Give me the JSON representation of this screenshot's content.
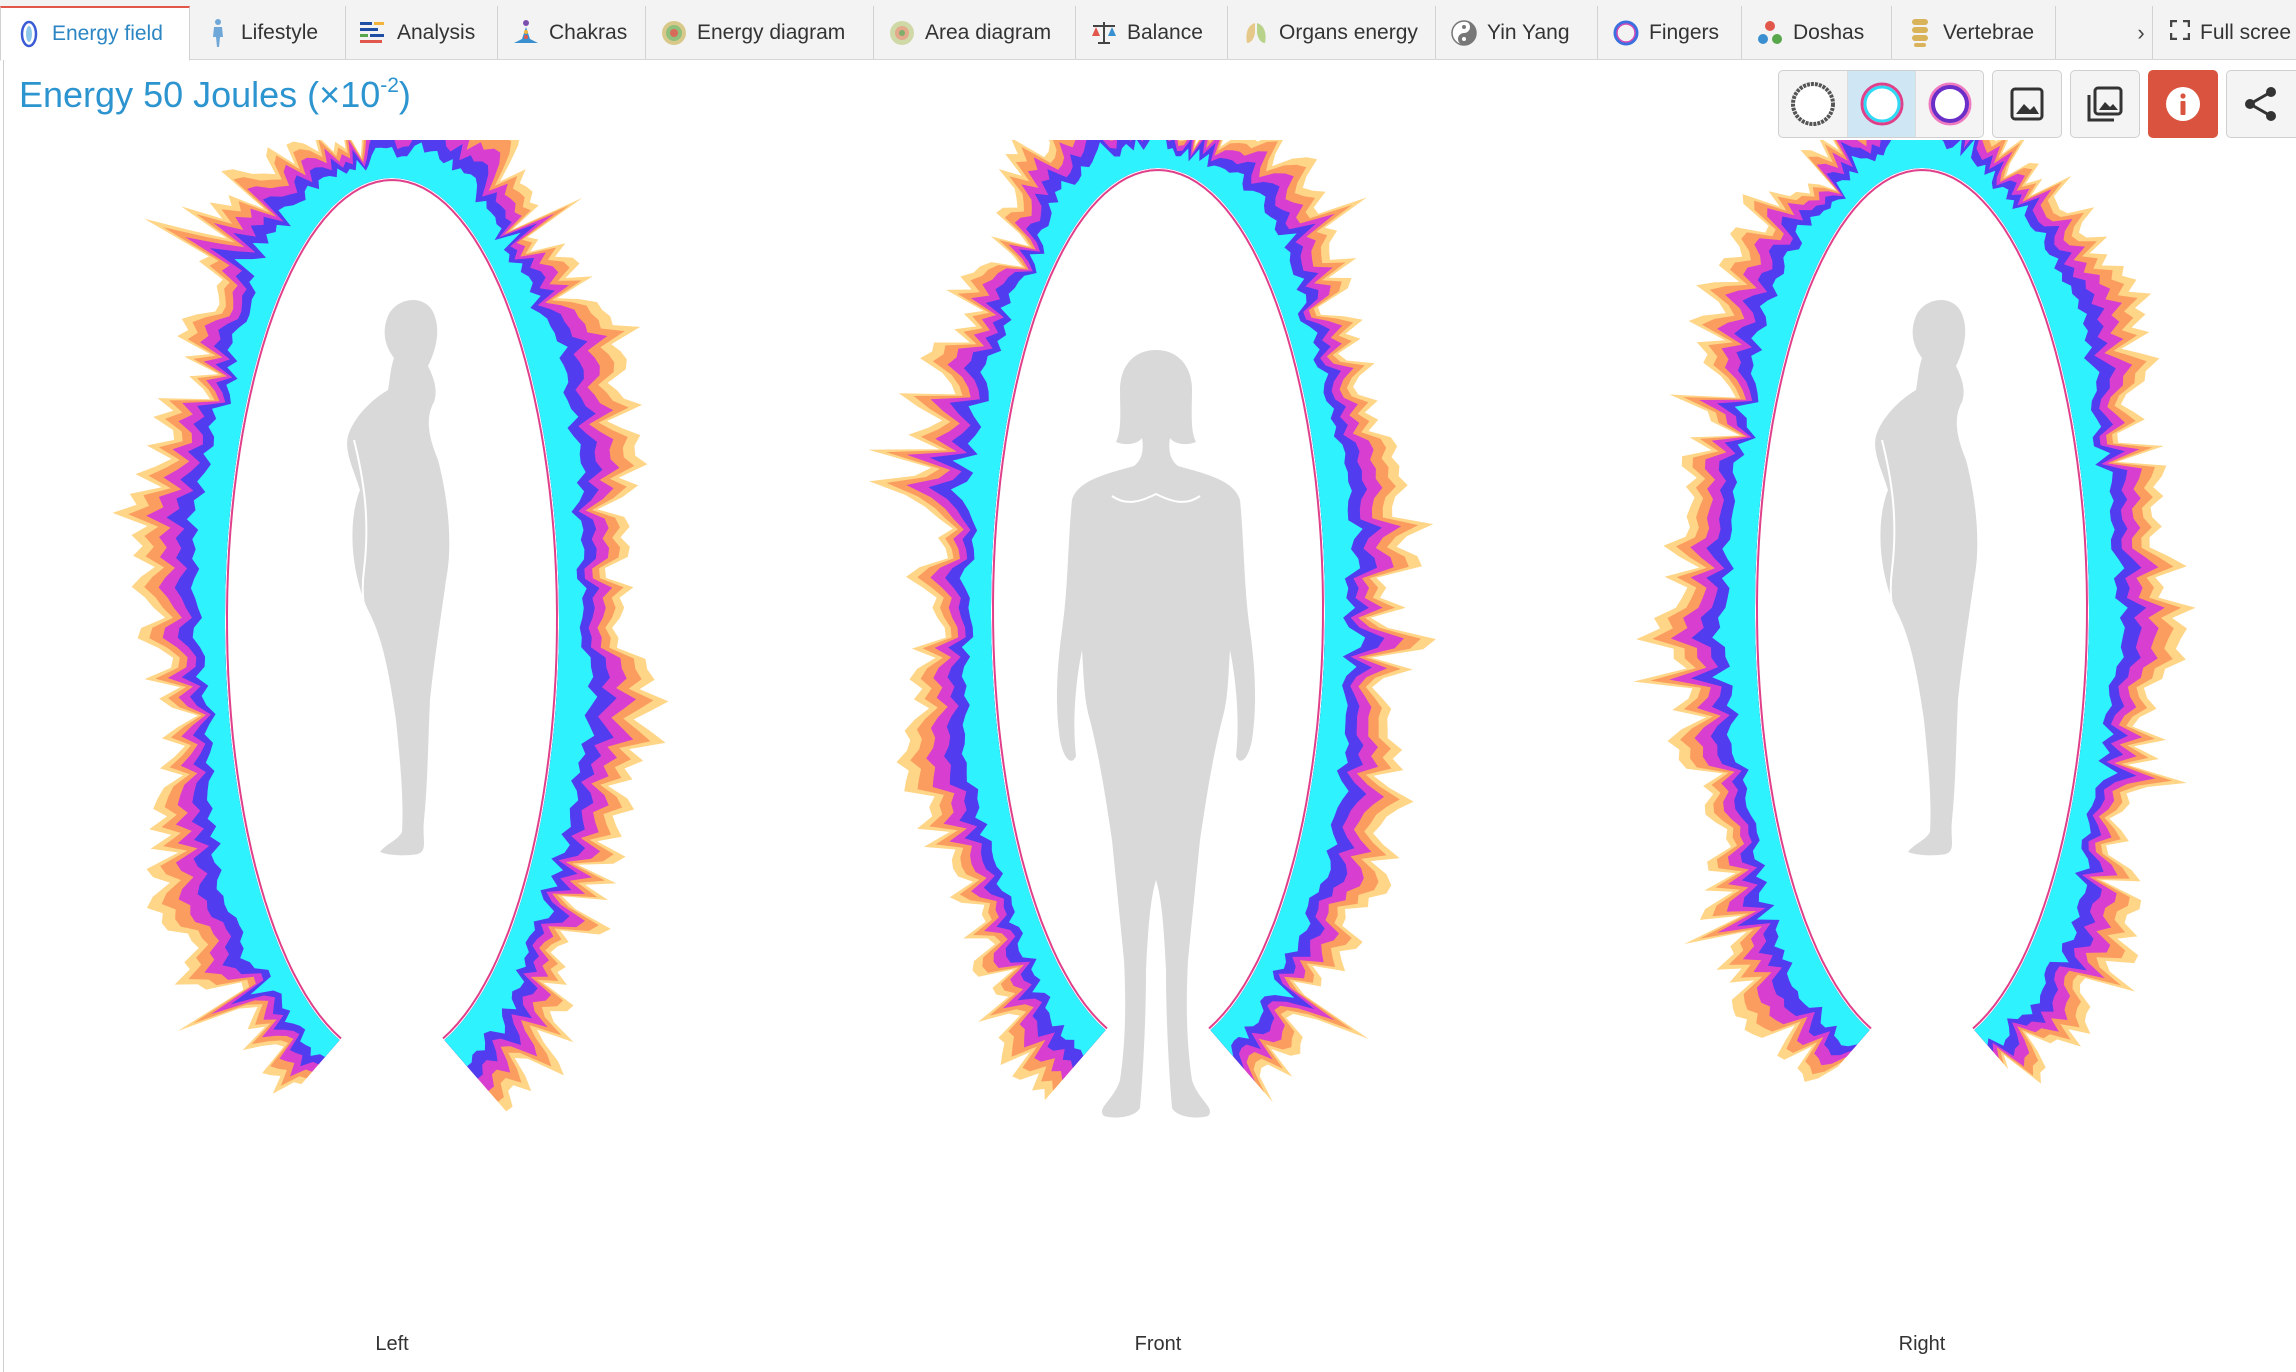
{
  "tabs": [
    {
      "label": "Energy field",
      "icon": "energy-field-icon",
      "active": true
    },
    {
      "label": "Lifestyle",
      "icon": "lifestyle-icon"
    },
    {
      "label": "Analysis",
      "icon": "analysis-icon"
    },
    {
      "label": "Chakras",
      "icon": "chakras-icon"
    },
    {
      "label": "Energy diagram",
      "icon": "energy-diagram-icon"
    },
    {
      "label": "Area diagram",
      "icon": "area-diagram-icon"
    },
    {
      "label": "Balance",
      "icon": "balance-icon"
    },
    {
      "label": "Organs energy",
      "icon": "organs-icon"
    },
    {
      "label": "Yin Yang",
      "icon": "yin-yang-icon"
    },
    {
      "label": "Fingers",
      "icon": "fingers-icon"
    },
    {
      "label": "Doshas",
      "icon": "doshas-icon"
    },
    {
      "label": "Vertebrae",
      "icon": "vertebrae-icon"
    }
  ],
  "scroll_label": "›",
  "fullscreen_label": "Full scree",
  "title": {
    "text": "Energy 50 Joules (×10",
    "exponent": "-2",
    "suffix": ")"
  },
  "toolbar": {
    "view_modes": [
      "ring-gray-icon",
      "ring-blue-icon",
      "ring-purple-icon"
    ],
    "selected_mode": 1,
    "actions": [
      "image-icon",
      "images-icon",
      "info-icon",
      "share-icon"
    ]
  },
  "views": [
    {
      "label": "Left",
      "figure": "side-profile"
    },
    {
      "label": "Front",
      "figure": "front"
    },
    {
      "label": "Right",
      "figure": "side-profile"
    }
  ],
  "colors": {
    "accent_blue": "#2c94cf",
    "info_red": "#d9533f",
    "aura_cyan": "#2ff2ff",
    "aura_blue": "#4a3cf0",
    "aura_magenta": "#d63ad6",
    "aura_orange": "#fb9a5c",
    "aura_yellow": "#ffd07a",
    "silhouette": "#d9d9d9"
  }
}
